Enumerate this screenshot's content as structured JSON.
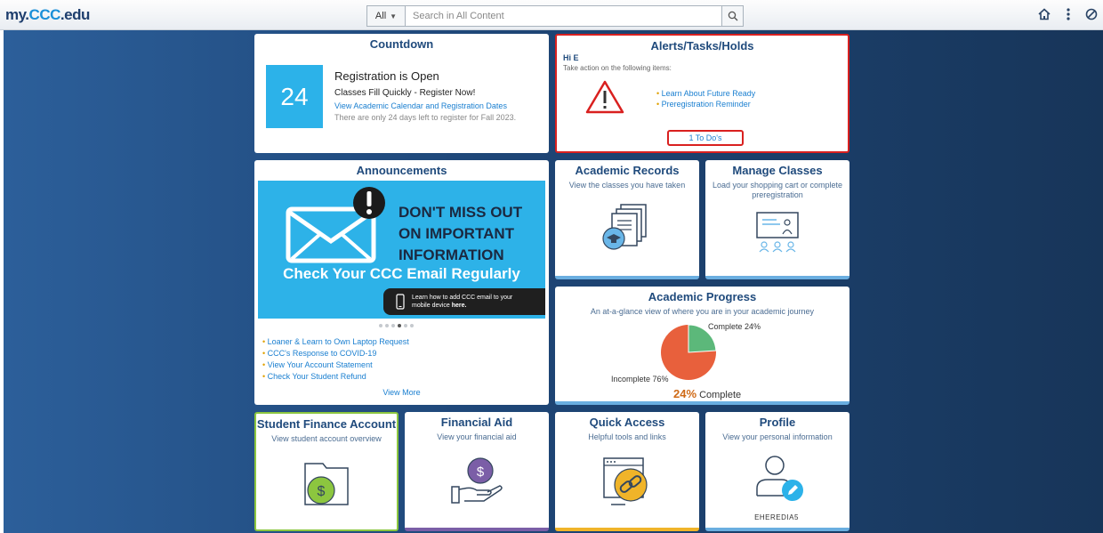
{
  "header": {
    "logo_my": "my.",
    "logo_ccc": "CCC",
    "logo_edu": ".edu",
    "search_scope": "All",
    "search_placeholder": "Search in All Content",
    "icons": [
      "home-icon",
      "more-vertical-icon",
      "navbar-compass-icon"
    ]
  },
  "countdown": {
    "title": "Countdown",
    "days": "24",
    "heading": "Registration is Open",
    "line1": "Classes Fill Quickly - Register Now!",
    "link": "View Academic Calendar and Registration Dates",
    "note": "There are only 24 days left to register for Fall 2023."
  },
  "alerts": {
    "title": "Alerts/Tasks/Holds",
    "greeting": "Hi E",
    "instruction": "Take action on the following items:",
    "items": [
      "Learn About Future Ready",
      "Preregistration Reminder"
    ],
    "todo": "1 To Do's"
  },
  "announcements": {
    "title": "Announcements",
    "banner_line1": "DON'T MISS OUT",
    "banner_line2": "ON IMPORTANT",
    "banner_line3": "INFORMATION",
    "banner_sub": "Check Your CCC Email Regularly",
    "banner_strip_a": "Learn how to add CCC email to your",
    "banner_strip_b": "mobile device ",
    "banner_strip_c": "here.",
    "carousel_total": 6,
    "carousel_active": 4,
    "links": [
      "Loaner & Learn to Own Laptop Request",
      "CCC's Response to COVID-19",
      "View Your Account Statement",
      "Check Your Student Refund"
    ],
    "view_more": "View More"
  },
  "academic_records": {
    "title": "Academic Records",
    "subtitle": "View the classes you have taken"
  },
  "manage_classes": {
    "title": "Manage Classes",
    "subtitle": "Load your shopping cart or complete preregistration"
  },
  "academic_progress": {
    "title": "Academic Progress",
    "subtitle": "An at-a-glance view of where you are in your academic journey",
    "complete_label": "Complete 24%",
    "incomplete_label": "Incomplete 76%",
    "pct_value": "24%",
    "pct_suffix": " Complete",
    "complete_fraction": 0.24,
    "color_complete": "#5cb87a",
    "color_incomplete": "#e8603c"
  },
  "student_finance": {
    "title": "Student Finance Account",
    "subtitle": "View student account overview"
  },
  "financial_aid": {
    "title": "Financial Aid",
    "subtitle": "View your financial aid"
  },
  "quick_access": {
    "title": "Quick Access",
    "subtitle": "Helpful tools and links"
  },
  "profile": {
    "title": "Profile",
    "subtitle": "View your personal information",
    "username": "EHEREDIA5"
  }
}
